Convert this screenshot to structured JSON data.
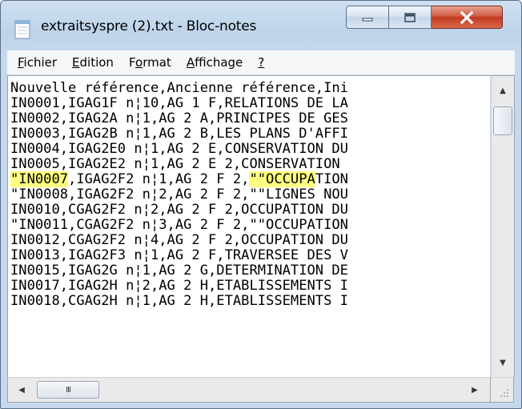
{
  "window": {
    "title": "extraitsyspre (2).txt - Bloc-notes",
    "icon": "notepad-icon"
  },
  "controls": {
    "minimize_icon": "minimize-icon",
    "maximize_icon": "maximize-icon",
    "close_icon": "close-icon"
  },
  "menu": [
    {
      "access": "F",
      "rest": "ichier"
    },
    {
      "access": "E",
      "rest": "dition"
    },
    {
      "pre": "F",
      "access": "o",
      "rest": "rmat"
    },
    {
      "access": "A",
      "rest": "ffichage"
    },
    {
      "access": "?",
      "rest": ""
    }
  ],
  "lines": [
    {
      "parts": [
        {
          "t": "Nouvelle référence,Ancienne référence,Ini"
        }
      ]
    },
    {
      "parts": [
        {
          "t": "IN0001,IGAG1F n¦10,AG 1 F,RELATIONS DE LA"
        }
      ]
    },
    {
      "parts": [
        {
          "t": "IN0002,IGAG2A n¦1,AG 2 A,PRINCIPES DE GES"
        }
      ]
    },
    {
      "parts": [
        {
          "t": "IN0003,IGAG2B n¦1,AG 2 B,LES PLANS D'AFFI"
        }
      ]
    },
    {
      "parts": [
        {
          "t": "IN0004,IGAG2E0 n¦1,AG 2 E,CONSERVATION DU"
        }
      ]
    },
    {
      "parts": [
        {
          "t": "IN0005,IGAG2E2 n¦1,AG 2 E 2,CONSERVATION "
        }
      ]
    },
    {
      "parts": [
        {
          "t": "\"IN0007",
          "hl": true
        },
        {
          "t": ",IGAG2F2 n¦1,AG 2 F 2,"
        },
        {
          "t": "\"\"OCCUPA",
          "hl": true
        },
        {
          "t": "TION"
        }
      ]
    },
    {
      "parts": [
        {
          "t": "\"IN0008,IGAG2F2 n¦2,AG 2 F 2,\"\"LIGNES NOU"
        }
      ]
    },
    {
      "parts": [
        {
          "t": "IN0010,CGAG2F2 n¦2,AG 2 F 2,OCCUPATION DU"
        }
      ]
    },
    {
      "parts": [
        {
          "t": "\"IN0011,CGAG2F2 n¦3,AG 2 F 2,\"\"OCCUPATION"
        }
      ]
    },
    {
      "parts": [
        {
          "t": "IN0012,CGAG2F2 n¦4,AG 2 F 2,OCCUPATION DU"
        }
      ]
    },
    {
      "parts": [
        {
          "t": "IN0013,IGAG2F3 n¦1,AG 2 F,TRAVERSEE DES V"
        }
      ]
    },
    {
      "parts": [
        {
          "t": "IN0015,IGAG2G n¦1,AG 2 G,DETERMINATION DE"
        }
      ]
    },
    {
      "parts": [
        {
          "t": "IN0017,IGAG2H n¦2,AG 2 H,ETABLISSEMENTS I"
        }
      ]
    },
    {
      "parts": [
        {
          "t": "IN0018,CGAG2H n¦1,AG 2 H,ETABLISSEMENTS I"
        }
      ]
    }
  ],
  "scrollbars": {
    "up_arrow": "▲",
    "down_arrow": "▼",
    "left_arrow": "◀",
    "right_arrow": "▶",
    "thumb_grip": "III",
    "size_grip_icon": "size-grip-icon"
  },
  "colors": {
    "highlight": "#ffff80",
    "close_button": "#c23a22"
  }
}
